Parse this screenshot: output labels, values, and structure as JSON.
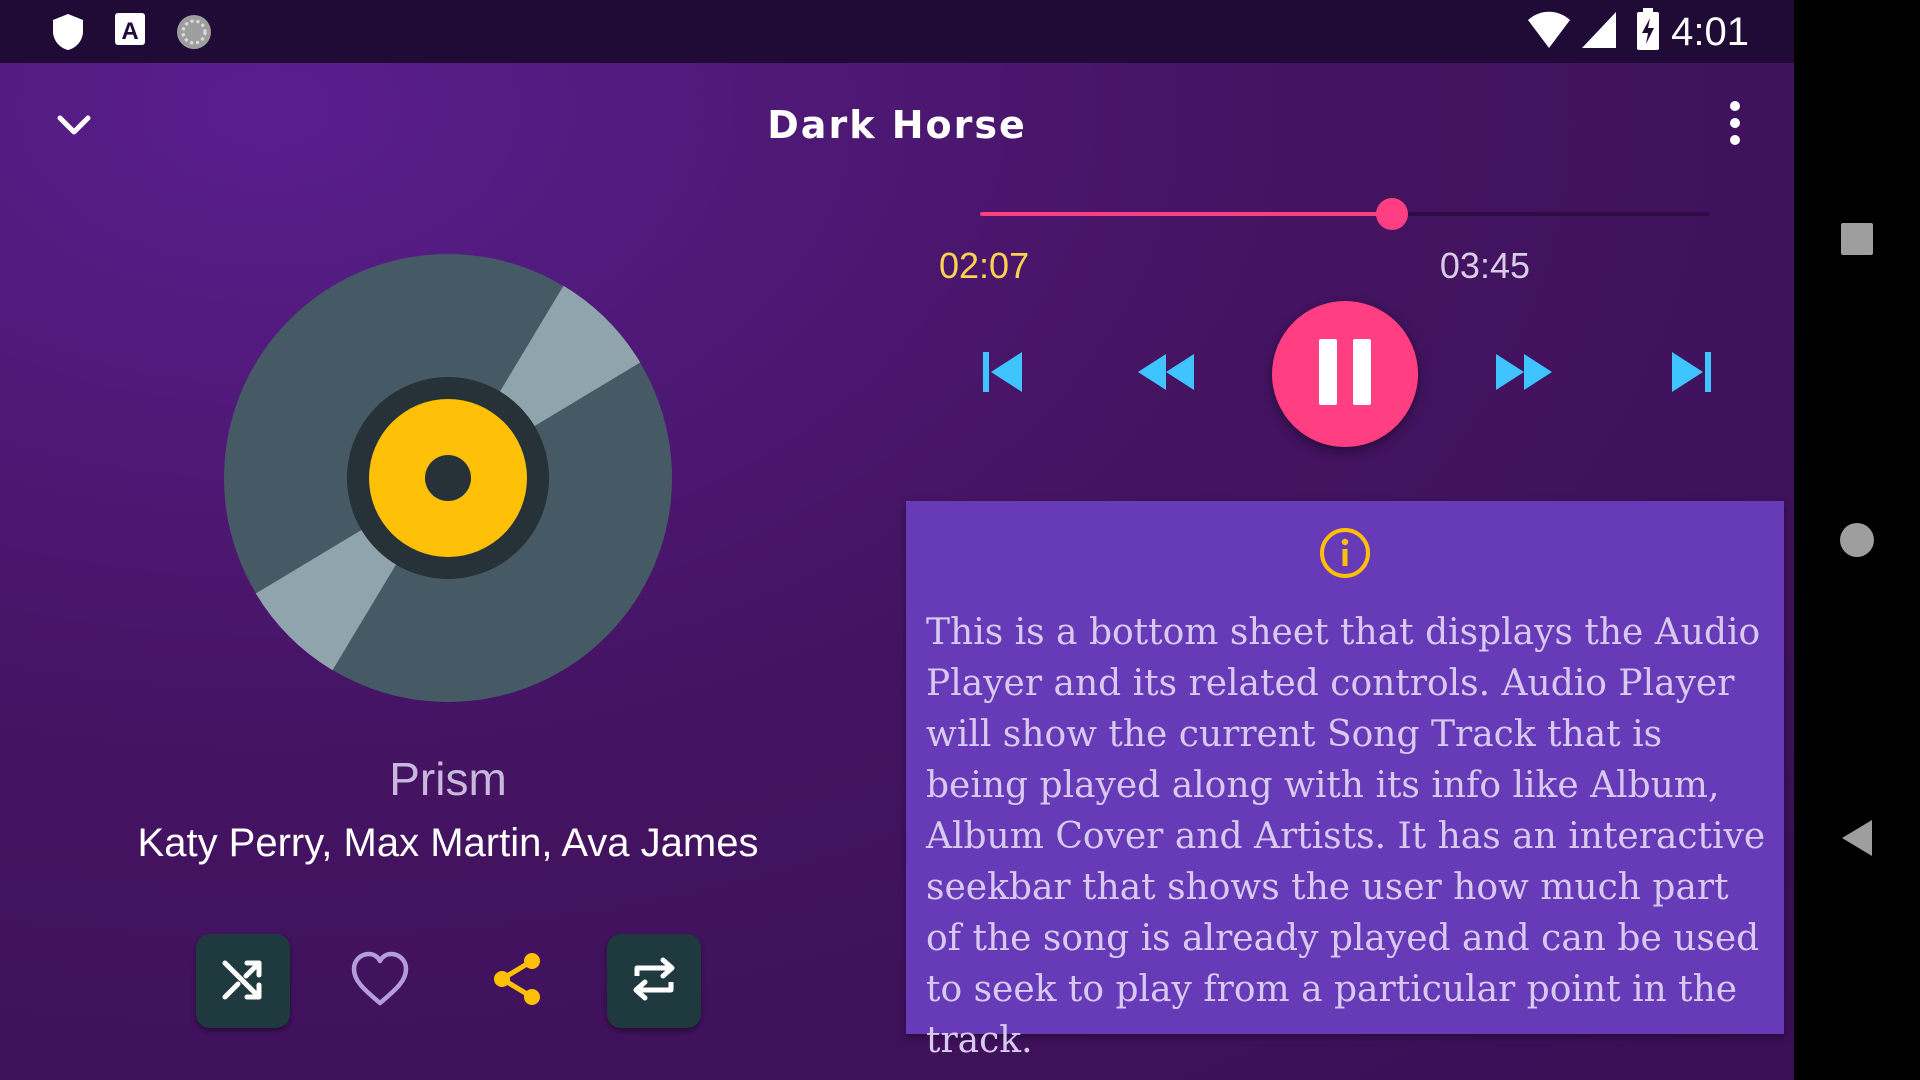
{
  "status_bar": {
    "time": "4:01",
    "left_icons": [
      "shield-icon",
      "font-a-icon",
      "sync-circle-icon"
    ],
    "right_icons": [
      "wifi-icon",
      "cell-signal-icon",
      "battery-charging-icon"
    ]
  },
  "header": {
    "title": "Dark Horse",
    "collapse_icon": "chevron-down-icon",
    "menu_icon": "more-vert-icon"
  },
  "now_playing": {
    "album": "Prism",
    "artists": "Katy Perry, Max Martin, Ava James"
  },
  "actions": [
    "shuffle-icon",
    "heart-icon",
    "share-icon",
    "repeat-icon"
  ],
  "seekbar": {
    "current_time": "02:07",
    "total_time": "03:45",
    "progress": 0.564
  },
  "controls": [
    "skip-previous-icon",
    "rewind-icon",
    "pause-icon",
    "fast-forward-icon",
    "skip-next-icon"
  ],
  "info": {
    "text": "This is a bottom sheet that displays the Audio Player and its related controls. Audio Player will show the current Song Track that is being played along with its info like Album, Album Cover and Artists. It has an interactive seekbar that shows the user how much part of the song is already played and can be used to seek to play from a particular point in the track."
  },
  "nav_bar": [
    "recents-square-icon",
    "home-circle-icon",
    "back-triangle-icon"
  ],
  "colors": {
    "accent": "#ff3f81",
    "time_current": "#ffd34e",
    "info_card": "#673ab7",
    "disc_body": "#455a64",
    "disc_label": "#ffc107",
    "control_blue": "#40c4ff",
    "share": "#ffc107"
  }
}
